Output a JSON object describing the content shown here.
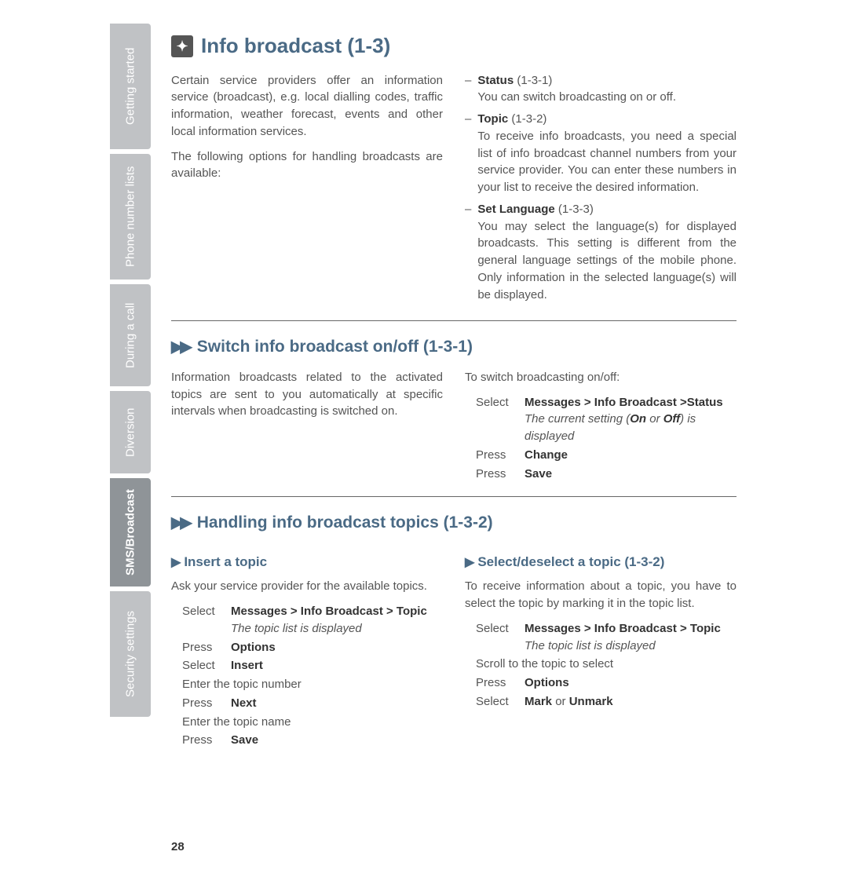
{
  "page_number": "28",
  "sidebar": {
    "tabs": [
      {
        "label": "Getting started"
      },
      {
        "label": "Phone number lists"
      },
      {
        "label": "During a call"
      },
      {
        "label": "Diversion"
      },
      {
        "label": "SMS/Broadcast"
      },
      {
        "label": "Security settings"
      }
    ]
  },
  "h1": "Info broadcast (1-3)",
  "intro_p1": "Certain service providers offer an information service (broadcast), e.g. local dialling codes, traffic information, weather forecast, events and other local information services.",
  "intro_p2": "The following options for handling broadcasts are available:",
  "opt_status": {
    "title": "Status",
    "code": "(1-3-1)",
    "text": "You can switch broadcasting on or off."
  },
  "opt_topic": {
    "title": "Topic",
    "code": "(1-3-2)",
    "text": "To receive info broadcasts, you need a special list of info broadcast channel numbers from your service provider. You can enter these numbers in your list to receive the desired information."
  },
  "opt_lang": {
    "title": "Set Language",
    "code": "(1-3-3)",
    "text": "You may select the language(s) for displayed broadcasts. This setting is different from the general language settings of the mobile phone. Only information in the selected language(s) will be displayed."
  },
  "h2a": "Switch info broadcast on/off (1-3-1)",
  "sec1_left": "Information broadcasts related to the activated topics are sent to you automatically at specific intervals when broadcasting is switched on.",
  "sec1_right_intro": "To switch broadcasting on/off:",
  "sec1_steps": {
    "s1_lbl": "Select",
    "s1_val": "Messages > Info Broadcast >Status",
    "s1_note_a": "The current setting (",
    "s1_note_b": "On",
    "s1_note_c": " or ",
    "s1_note_d": "Off",
    "s1_note_e": ") is displayed",
    "s2_lbl": "Press",
    "s2_val": "Change",
    "s3_lbl": "Press",
    "s3_val": "Save"
  },
  "h2b": "Handling info broadcast topics (1-3-2)",
  "h3a": "Insert a topic",
  "sec2_left_intro": "Ask your service provider for the available topics.",
  "sec2_left_steps": {
    "s1_lbl": "Select",
    "s1_val": "Messages > Info Broadcast > Topic",
    "s1_note": "The topic list is displayed",
    "s2_lbl": "Press",
    "s2_val": "Options",
    "s3_lbl": "Select",
    "s3_val": "Insert",
    "line4": "Enter the topic number",
    "s5_lbl": "Press",
    "s5_val": "Next",
    "line6": "Enter the topic name",
    "s7_lbl": "Press",
    "s7_val": "Save"
  },
  "h3b": "Select/deselect a topic (1-3-2)",
  "sec2_right_intro": "To receive information about a topic, you have to select the topic by marking it in the topic list.",
  "sec2_right_steps": {
    "s1_lbl": "Select",
    "s1_val": "Messages > Info Broadcast > Topic",
    "s1_note": "The topic list is displayed",
    "line2": "Scroll to the topic to select",
    "s3_lbl": "Press",
    "s3_val": "Options",
    "s4_lbl": "Select",
    "s4_val_a": "Mark",
    "s4_mid": " or ",
    "s4_val_b": "Unmark"
  }
}
